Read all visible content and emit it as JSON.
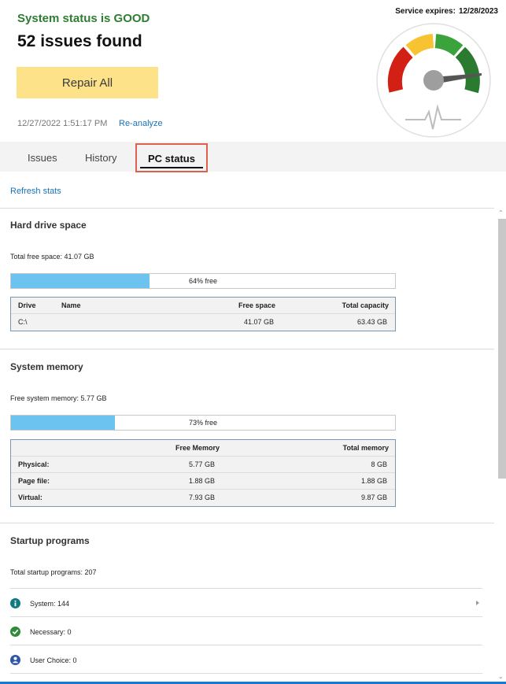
{
  "header": {
    "status_text": "System status is GOOD",
    "issues_text": "52 issues found",
    "repair_label": "Repair All",
    "timestamp": "12/27/2022 1:51:17 PM",
    "reanalyze_label": "Re-analyze",
    "service_label": "Service expires:",
    "service_date": "12/28/2023",
    "gauge_icon": "health-gauge-icon",
    "colors": {
      "status": "#2e7d32",
      "repair_button": "#fde28a",
      "link": "#1a73b8"
    }
  },
  "tabs": [
    {
      "label": "Issues",
      "selected": false
    },
    {
      "label": "History",
      "selected": false
    },
    {
      "label": "PC status",
      "selected": true
    }
  ],
  "refresh_label": "Refresh stats",
  "hard_drive": {
    "title": "Hard drive space",
    "total_free": "Total free space: 41.07 GB",
    "bar_label": "64% free",
    "fill_percent": 36,
    "columns": [
      "Drive",
      "Name",
      "Free space",
      "Total capacity"
    ],
    "rows": [
      {
        "drive": "C:\\",
        "name": "",
        "free": "41.07 GB",
        "total": "63.43 GB"
      }
    ]
  },
  "memory": {
    "title": "System memory",
    "free_text": "Free system memory: 5.77 GB",
    "bar_label": "73% free",
    "fill_percent": 27,
    "columns": [
      "",
      "Free Memory",
      "Total memory"
    ],
    "rows": [
      {
        "label": "Physical:",
        "free": "5.77 GB",
        "total": "8 GB"
      },
      {
        "label": "Page file:",
        "free": "1.88 GB",
        "total": "1.88 GB"
      },
      {
        "label": "Virtual:",
        "free": "7.93 GB",
        "total": "9.87 GB"
      }
    ]
  },
  "startup": {
    "title": "Startup programs",
    "total_text": "Total startup programs: 207",
    "items": [
      {
        "label": "System: 144",
        "icon": "info-icon",
        "color": "#0f7a80"
      },
      {
        "label": "Necessary: 0",
        "icon": "check-circle-icon",
        "color": "#2e8b3a"
      },
      {
        "label": "User Choice: 0",
        "icon": "user-icon",
        "color": "#2f55a8"
      }
    ]
  }
}
